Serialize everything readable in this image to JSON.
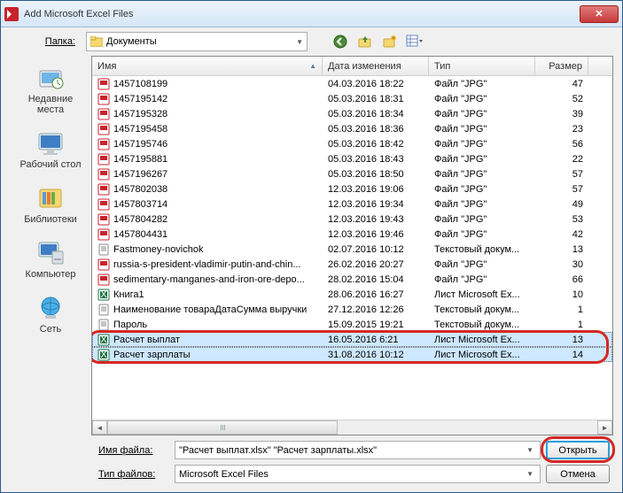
{
  "window": {
    "title": "Add Microsoft Excel Files"
  },
  "toolbar": {
    "folder_label": "Папка:",
    "folder_value": "Документы",
    "icons": [
      "back-icon",
      "up-icon",
      "new-folder-icon",
      "view-mode-icon"
    ]
  },
  "places": [
    {
      "label": "Недавние места",
      "icon": "recent"
    },
    {
      "label": "Рабочий стол",
      "icon": "desktop"
    },
    {
      "label": "Библиотеки",
      "icon": "libraries"
    },
    {
      "label": "Компьютер",
      "icon": "computer"
    },
    {
      "label": "Сеть",
      "icon": "network"
    }
  ],
  "columns": {
    "name": "Имя",
    "date": "Дата изменения",
    "type": "Тип",
    "size": "Размер"
  },
  "files": [
    {
      "name": "1457108199",
      "date": "04.03.2016 18:22",
      "type": "Файл \"JPG\"",
      "size": "47",
      "icon": "jpg"
    },
    {
      "name": "1457195142",
      "date": "05.03.2016 18:31",
      "type": "Файл \"JPG\"",
      "size": "52",
      "icon": "jpg"
    },
    {
      "name": "1457195328",
      "date": "05.03.2016 18:34",
      "type": "Файл \"JPG\"",
      "size": "39",
      "icon": "jpg"
    },
    {
      "name": "1457195458",
      "date": "05.03.2016 18:36",
      "type": "Файл \"JPG\"",
      "size": "23",
      "icon": "jpg"
    },
    {
      "name": "1457195746",
      "date": "05.03.2016 18:42",
      "type": "Файл \"JPG\"",
      "size": "56",
      "icon": "jpg"
    },
    {
      "name": "1457195881",
      "date": "05.03.2016 18:43",
      "type": "Файл \"JPG\"",
      "size": "22",
      "icon": "jpg"
    },
    {
      "name": "1457196267",
      "date": "05.03.2016 18:50",
      "type": "Файл \"JPG\"",
      "size": "57",
      "icon": "jpg"
    },
    {
      "name": "1457802038",
      "date": "12.03.2016 19:06",
      "type": "Файл \"JPG\"",
      "size": "57",
      "icon": "jpg"
    },
    {
      "name": "1457803714",
      "date": "12.03.2016 19:34",
      "type": "Файл \"JPG\"",
      "size": "49",
      "icon": "jpg"
    },
    {
      "name": "1457804282",
      "date": "12.03.2016 19:43",
      "type": "Файл \"JPG\"",
      "size": "53",
      "icon": "jpg"
    },
    {
      "name": "1457804431",
      "date": "12.03.2016 19:46",
      "type": "Файл \"JPG\"",
      "size": "42",
      "icon": "jpg"
    },
    {
      "name": "Fastmoney-novichok",
      "date": "02.07.2016 10:12",
      "type": "Текстовый докум...",
      "size": "13",
      "icon": "txt"
    },
    {
      "name": "russia-s-president-vladimir-putin-and-chin...",
      "date": "26.02.2016 20:27",
      "type": "Файл \"JPG\"",
      "size": "30",
      "icon": "jpg"
    },
    {
      "name": "sedimentary-manganes-and-iron-ore-depo...",
      "date": "28.02.2016 15:04",
      "type": "Файл \"JPG\"",
      "size": "66",
      "icon": "jpg"
    },
    {
      "name": "Книга1",
      "date": "28.06.2016 16:27",
      "type": "Лист Microsoft Ex...",
      "size": "10",
      "icon": "xls"
    },
    {
      "name": "Наименование товараДатаСумма выручки",
      "date": "27.12.2016 12:26",
      "type": "Текстовый докум...",
      "size": "1",
      "icon": "txt"
    },
    {
      "name": "Пароль",
      "date": "15.09.2015 19:21",
      "type": "Текстовый докум...",
      "size": "1",
      "icon": "txt"
    },
    {
      "name": "Расчет выплат",
      "date": "16.05.2016 6:21",
      "type": "Лист Microsoft Ex...",
      "size": "13",
      "icon": "xls",
      "selected": true
    },
    {
      "name": "Расчет зарплаты",
      "date": "31.08.2016 10:12",
      "type": "Лист Microsoft Ex...",
      "size": "14",
      "icon": "xls",
      "selected": true
    }
  ],
  "footer": {
    "filename_label": "Имя файла:",
    "filename_value": "\"Расчет выплат.xlsx\" \"Расчет зарплаты.xlsx\"",
    "filter_label": "Тип файлов:",
    "filter_value": "Microsoft Excel Files",
    "open_label": "Открыть",
    "cancel_label": "Отмена"
  }
}
